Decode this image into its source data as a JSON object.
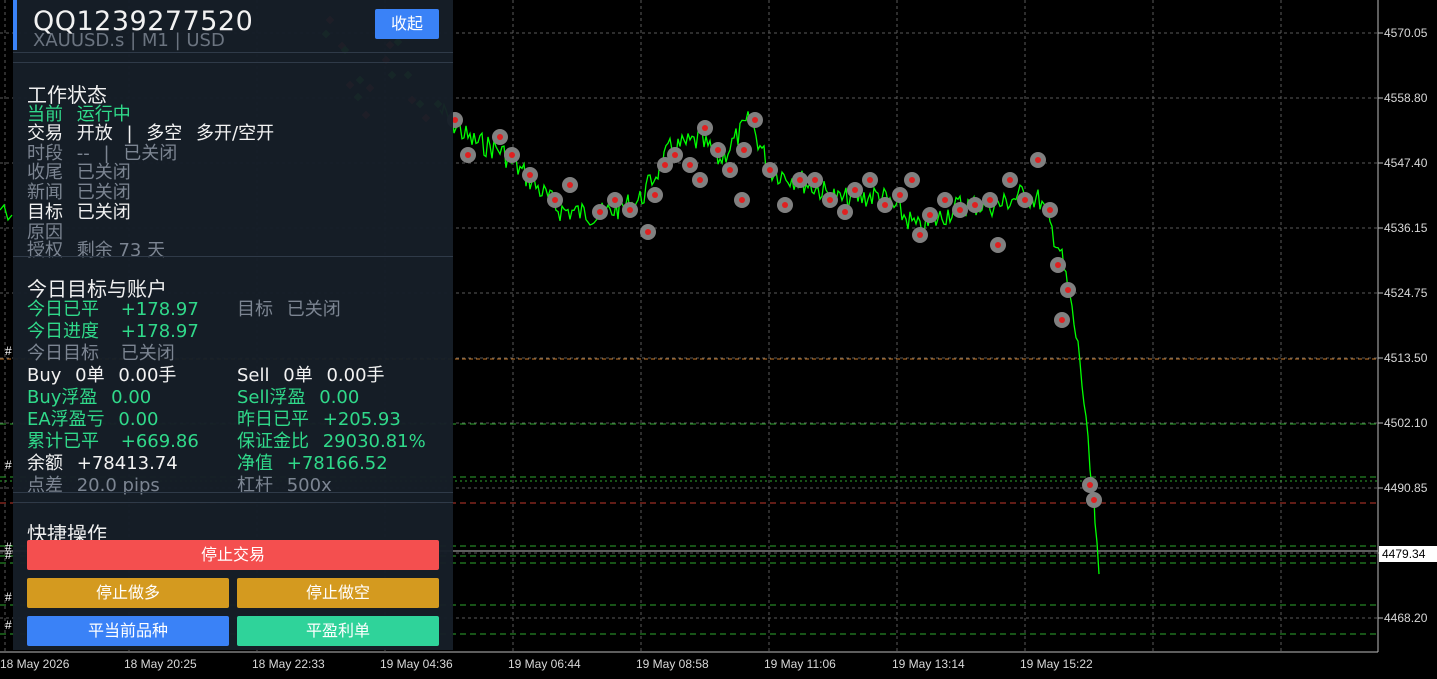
{
  "chart": {
    "price_levels": [
      "4570.05",
      "4558.80",
      "4547.40",
      "4536.15",
      "4524.75",
      "4513.50",
      "4502.10",
      "4490.85",
      "4479.34",
      "4468.20"
    ],
    "current_price": "4479.34",
    "time_labels": [
      "18 May 2026",
      "18 May 20:25",
      "18 May 22:33",
      "19 May 04:36",
      "19 May 06:44",
      "19 May 08:58",
      "19 May 11:06",
      "19 May 13:14",
      "19 May 15:22"
    ],
    "hash_mark": "#",
    "colors": {
      "price_line": "#00ff00",
      "grid": "#5a5a5a",
      "order_marker": "#808080"
    }
  },
  "panel": {
    "account": "QQ1239277520",
    "subline": "XAUUSD.s | M1 | USD",
    "collapse_label": "收起",
    "status": {
      "title": "工作状态",
      "current_key": "当前",
      "current_val": "运行中",
      "trade_key": "交易",
      "trade_val": "开放",
      "trade_sep": "|",
      "trade_dir": "多空",
      "trade_mode": "多开/空开",
      "period_key": "时段",
      "period_val": "--",
      "period_sep": "|",
      "period_state": "已关闭",
      "tail_key": "收尾",
      "tail_val": "已关闭",
      "news_key": "新闻",
      "news_val": "已关闭",
      "target_key": "目标",
      "target_val": "已关闭",
      "reason_key": "原因",
      "license_key": "授权",
      "license_val": "剩余 73 天"
    },
    "account_info": {
      "title": "今日目标与账户",
      "today_closed_key": "今日已平",
      "today_closed_val": "+178.97",
      "target_key": "目标",
      "target_val": "已关闭",
      "progress_key": "今日进度",
      "progress_val": "+178.97",
      "today_target_key": "今日目标",
      "today_target_val": "已关闭",
      "buy_key": "Buy",
      "buy_orders": "0单",
      "buy_lots": "0.00手",
      "sell_key": "Sell",
      "sell_orders": "0单",
      "sell_lots": "0.00手",
      "buy_float_key": "Buy浮盈",
      "buy_float_val": "0.00",
      "sell_float_key": "Sell浮盈",
      "sell_float_val": "0.00",
      "ea_float_key": "EA浮盈亏",
      "ea_float_val": "0.00",
      "yesterday_key": "昨日已平",
      "yesterday_val": "+205.93",
      "total_key": "累计已平",
      "total_val": "+669.86",
      "margin_key": "保证金比",
      "margin_val": "29030.81%",
      "balance_key": "余额",
      "balance_val": "+78413.74",
      "equity_key": "净值",
      "equity_val": "+78166.52",
      "spread_key": "点差",
      "spread_val": "20.0 pips",
      "leverage_key": "杠杆",
      "leverage_val": "500x"
    },
    "quick": {
      "title": "快捷操作",
      "stop_trading": "停止交易",
      "stop_long": "停止做多",
      "stop_short": "停止做空",
      "close_symbol": "平当前品种",
      "close_profit": "平盈利单"
    },
    "colors": {
      "red": "#f44f4f",
      "amber": "#d49a1f",
      "blue": "#3a82f7",
      "teal": "#2fd39a"
    }
  }
}
